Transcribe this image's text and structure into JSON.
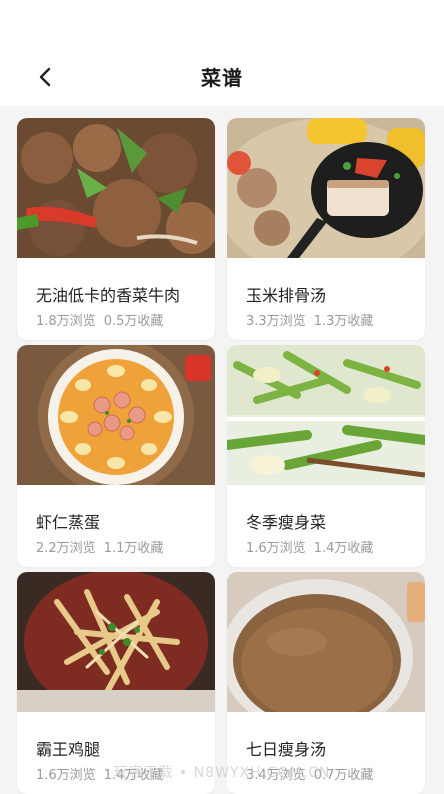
{
  "header": {
    "title": "菜谱",
    "back_icon": "chevron-left-icon"
  },
  "recipes": [
    {
      "name": "无油低卡的香菜牛肉",
      "views": "1.8万浏览",
      "favorites": "0.5万收藏"
    },
    {
      "name": "玉米排骨汤",
      "views": "3.3万浏览",
      "favorites": "1.3万收藏"
    },
    {
      "name": "虾仁蒸蛋",
      "views": "2.2万浏览",
      "favorites": "1.1万收藏"
    },
    {
      "name": "冬季瘦身菜",
      "views": "1.6万浏览",
      "favorites": "1.4万收藏"
    },
    {
      "name": "霸王鸡腿",
      "views": "1.6万浏览",
      "favorites": "1.4万收藏"
    },
    {
      "name": "七日瘦身汤",
      "views": "3.4万浏览",
      "favorites": "0.7万收藏"
    }
  ],
  "watermark": "玩客下载 • N8WYXH.COM.CN"
}
